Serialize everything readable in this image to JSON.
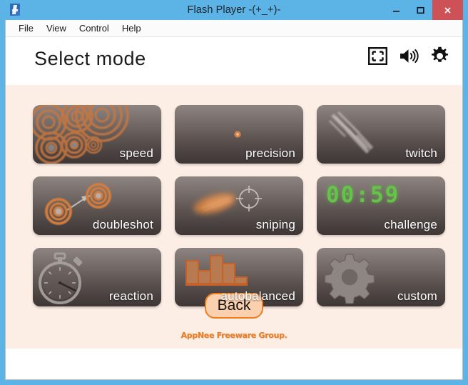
{
  "window": {
    "title": "Flash Player  -(+_+)-",
    "app_icon": "flash-player-icon",
    "controls": {
      "minimize": "minimize-icon",
      "maximize": "maximize-icon",
      "close": "close-icon"
    },
    "accent_color": "#5bb4e5",
    "close_color": "#cc5258"
  },
  "menubar": {
    "items": [
      {
        "label": "File"
      },
      {
        "label": "View"
      },
      {
        "label": "Control"
      },
      {
        "label": "Help"
      }
    ]
  },
  "stage": {
    "page_title": "Select mode",
    "background_color": "#fdeee5",
    "header_icons": [
      {
        "name": "fullscreen-icon"
      },
      {
        "name": "volume-icon"
      },
      {
        "name": "settings-gear-icon"
      }
    ]
  },
  "modes": [
    {
      "label": "speed",
      "art": "concentric-targets"
    },
    {
      "label": "precision",
      "art": "single-small-dot"
    },
    {
      "label": "twitch",
      "art": "motion-streaks"
    },
    {
      "label": "doubleshot",
      "art": "two-targets-arrow"
    },
    {
      "label": "sniping",
      "art": "blurred-blob-crosshair"
    },
    {
      "label": "challenge",
      "art": "digital-timer",
      "timer": "00:59",
      "timer_color": "#63c447"
    },
    {
      "label": "reaction",
      "art": "stopwatch"
    },
    {
      "label": "autobalanced",
      "art": "bar-chart"
    },
    {
      "label": "custom",
      "art": "gear"
    }
  ],
  "footer": {
    "back_label": "Back",
    "back_border_color": "#f07d1d",
    "back_fill_color": "#fbd0ae",
    "watermark": "AppNee Freeware Group."
  }
}
